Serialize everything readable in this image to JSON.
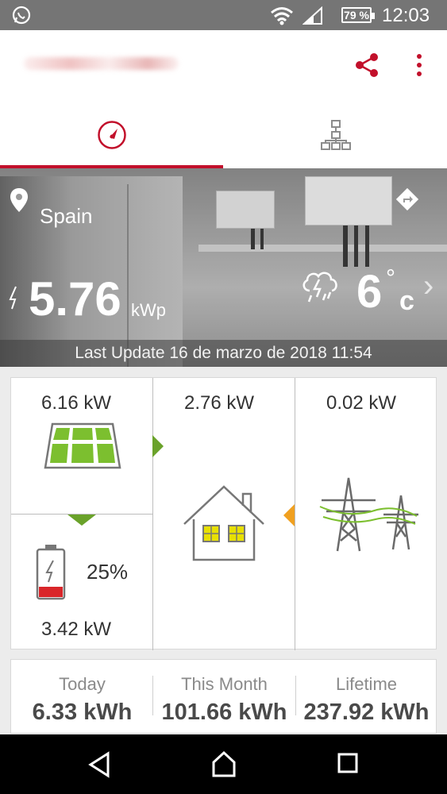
{
  "status_bar": {
    "battery": "79 %",
    "time": "12:03",
    "icons": [
      "whatsapp-icon",
      "wifi-icon",
      "signal-icon",
      "battery-icon"
    ]
  },
  "app_bar": {
    "icons": [
      "share-icon",
      "more-vert-icon"
    ]
  },
  "tabs": [
    {
      "icon": "dashboard-gauge-icon",
      "selected": true
    },
    {
      "icon": "layout-hierarchy-icon",
      "selected": false
    }
  ],
  "site": {
    "location": "Spain",
    "peak_power_value": "5.76",
    "peak_power_unit": "kWp",
    "temperature_value": "6",
    "temperature_deg": "°",
    "temperature_unit": "c",
    "weather_icon": "thunderstorm-rain-icon",
    "last_update": "Last Update 16 de marzo de 2018 11:54"
  },
  "flow": {
    "pv_power": "6.16 kW",
    "consumption": "2.76 kW",
    "grid_power": "0.02 kW",
    "battery_level": "25%",
    "battery_level_fraction": 0.25,
    "battery_power": "3.42 kW"
  },
  "energy": {
    "today_label": "Today",
    "today_value": "6.33 kWh",
    "month_label": "This Month",
    "month_value": "101.66 kWh",
    "lifetime_label": "Lifetime",
    "lifetime_value": "237.92 kWh"
  },
  "colors": {
    "accent": "#c2102b",
    "pv_green": "#7cbf2f",
    "battery_red": "#d9262a",
    "grid_orange": "#f0a020",
    "house_yellow": "#e8e000"
  }
}
